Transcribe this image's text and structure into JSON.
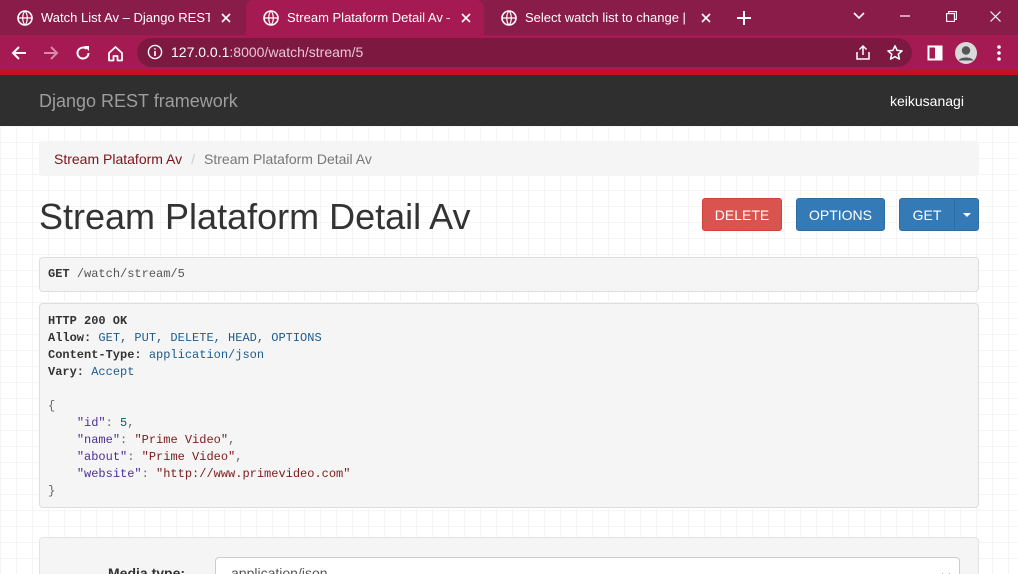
{
  "browser": {
    "tabs": [
      {
        "title": "Watch List Av – Django REST framework",
        "active": false
      },
      {
        "title": "Stream Plataform Detail Av – Django REST framework",
        "active": true
      },
      {
        "title": "Select watch list to change | Django site admin",
        "active": false
      }
    ],
    "url_host": "127.0.0.1",
    "url_rest": ":8000/watch/stream/5",
    "colors": {
      "tabbar": "#8a1c49",
      "toolbar": "#a51a52",
      "accent_line": "#c70f1e"
    }
  },
  "navbar": {
    "brand": "Django REST framework",
    "user": "keikusanagi"
  },
  "breadcrumb": {
    "link": "Stream Plataform Av",
    "separator": "/",
    "active": "Stream Plataform Detail Av"
  },
  "page": {
    "title": "Stream Plataform Detail Av"
  },
  "buttons": {
    "delete": "DELETE",
    "options": "OPTIONS",
    "get": "GET"
  },
  "request": {
    "method": "GET",
    "path": "/watch/stream/5"
  },
  "response": {
    "status": "HTTP 200 OK",
    "allow_label": "Allow:",
    "allow_value": "GET, PUT, DELETE, HEAD, OPTIONS",
    "content_type_label": "Content-Type:",
    "content_type_value": "application/json",
    "vary_label": "Vary:",
    "vary_value": "Accept",
    "body": {
      "open": "{",
      "close": "}",
      "id_key": "\"id\"",
      "id_value": "5",
      "name_key": "\"name\"",
      "name_value": "\"Prime Video\"",
      "about_key": "\"about\"",
      "about_value": "\"Prime Video\"",
      "website_key": "\"website\"",
      "website_value": "\"http://www.primevideo.com\""
    }
  },
  "form": {
    "media_type_label": "Media type:",
    "media_type_value": "application/json"
  }
}
